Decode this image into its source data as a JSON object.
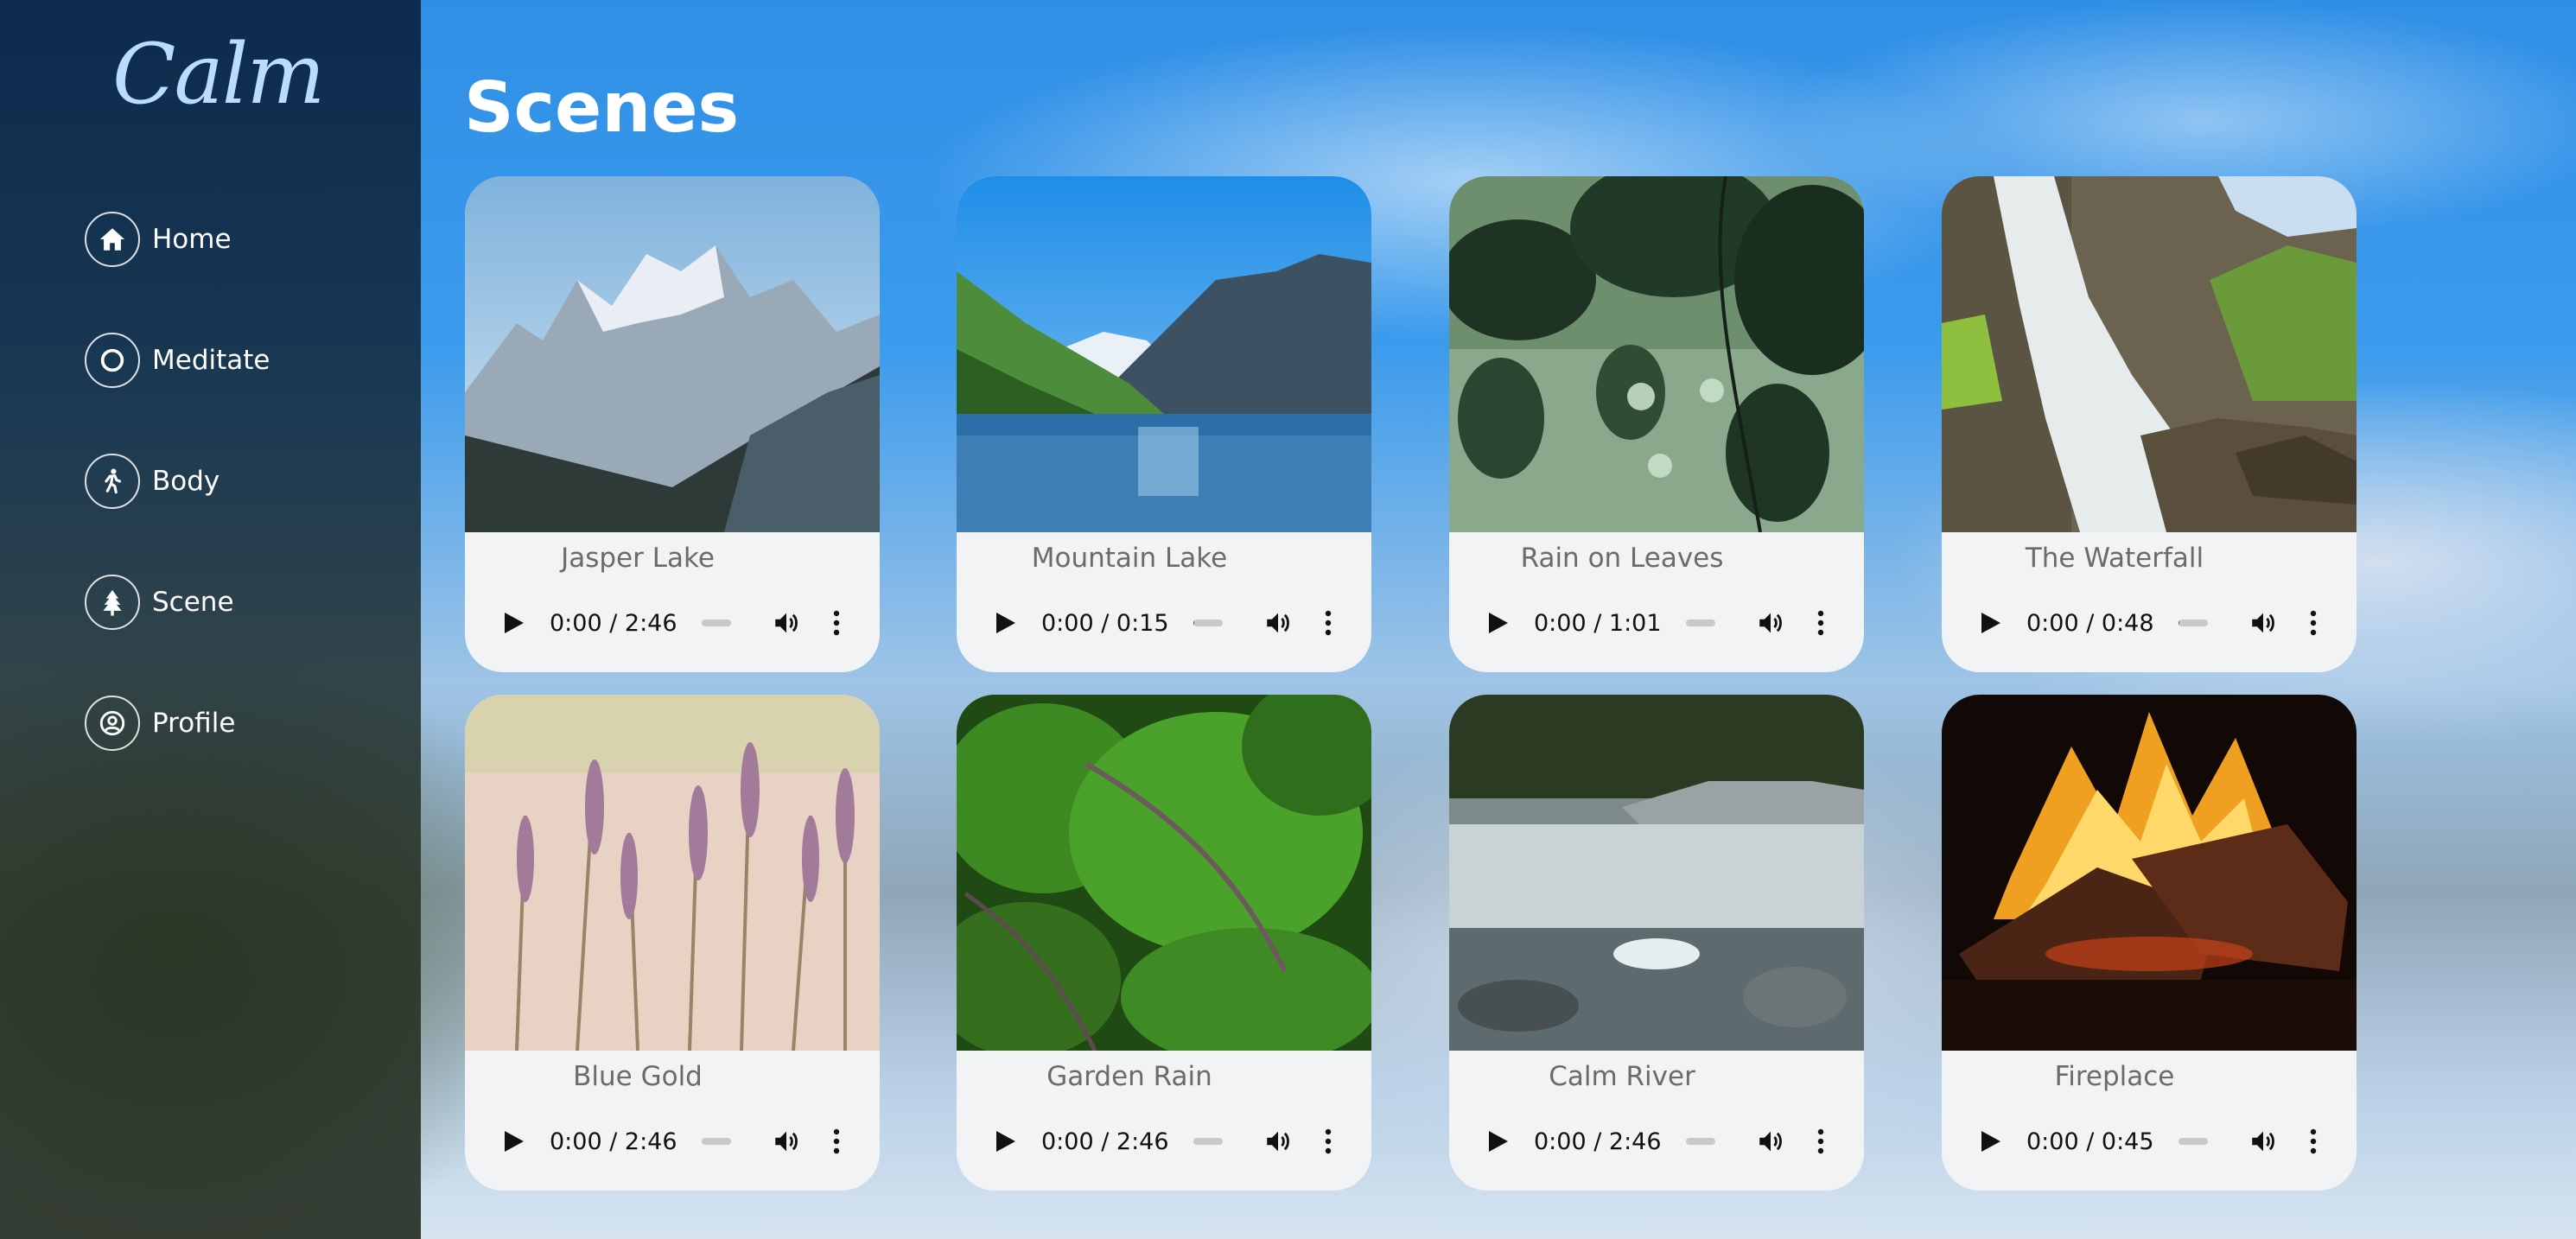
{
  "app": {
    "logo_text": "Calm"
  },
  "sidebar": {
    "items": [
      {
        "label": "Home",
        "icon": "home-icon"
      },
      {
        "label": "Meditate",
        "icon": "circle-icon"
      },
      {
        "label": "Body",
        "icon": "walking-person-icon"
      },
      {
        "label": "Scene",
        "icon": "tree-icon"
      },
      {
        "label": "Profile",
        "icon": "user-circle-icon"
      }
    ]
  },
  "main": {
    "title": "Scenes",
    "scenes": [
      {
        "title": "Jasper Lake",
        "time": "0:00 / 2:46",
        "progress": 0
      },
      {
        "title": "Mountain Lake",
        "time": "0:00 / 0:15",
        "progress": 0.05
      },
      {
        "title": "Rain on Leaves",
        "time": "0:00 / 1:01",
        "progress": 0
      },
      {
        "title": "The Waterfall",
        "time": "0:00 / 0:48",
        "progress": 0.05
      },
      {
        "title": "Blue Gold",
        "time": "0:00 / 2:46",
        "progress": 0
      },
      {
        "title": "Garden Rain",
        "time": "0:00 / 2:46",
        "progress": 0
      },
      {
        "title": "Calm River",
        "time": "0:00 / 2:46",
        "progress": 0
      },
      {
        "title": "Fireplace",
        "time": "0:00 / 0:45",
        "progress": 0
      }
    ]
  },
  "colors": {
    "sidebar_bg": "#0f2740",
    "logo": "#b9dcff",
    "card_bg": "#f1f3f4",
    "card_title": "#6b6b6b"
  }
}
